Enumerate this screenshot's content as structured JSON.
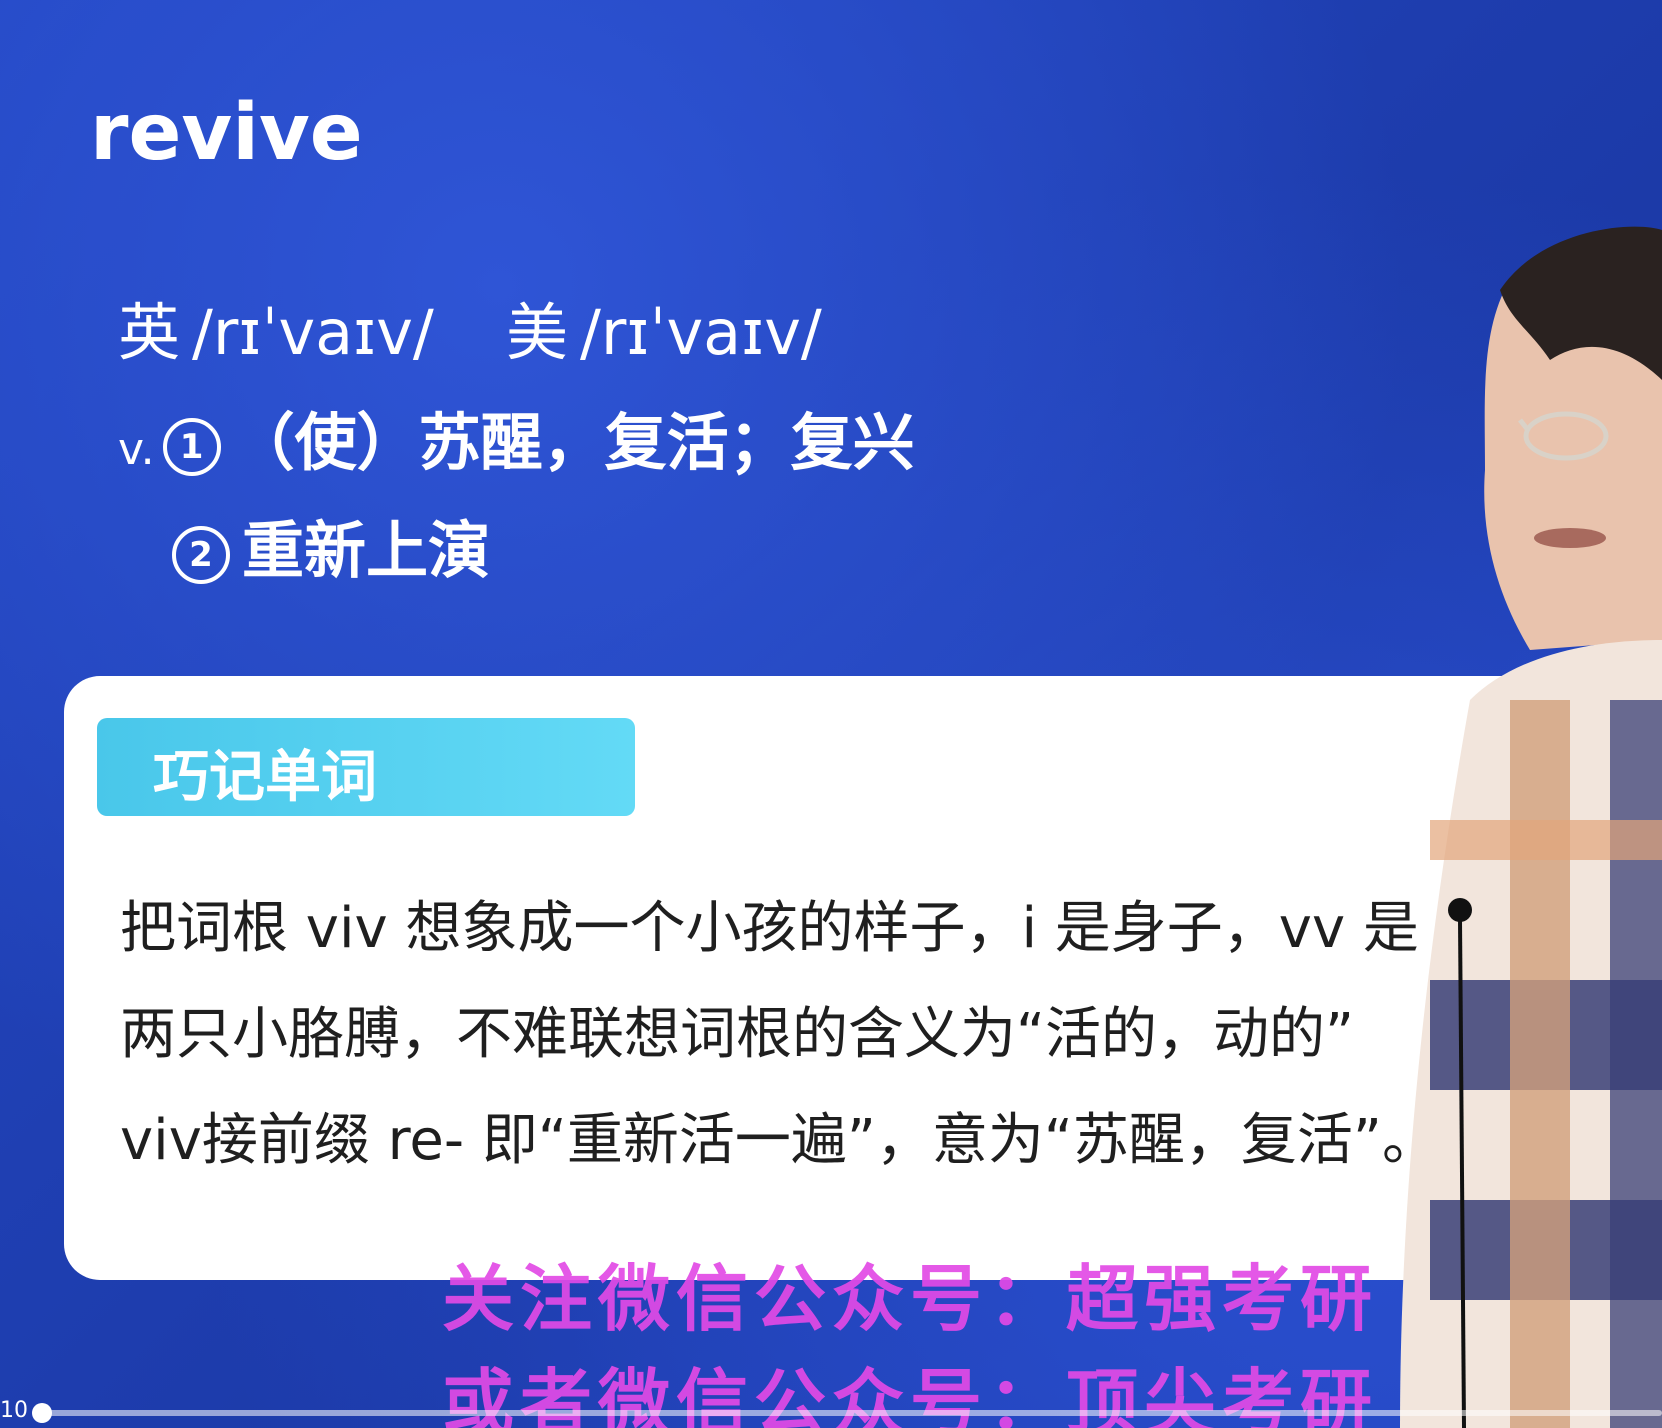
{
  "slide": {
    "word": "revive",
    "phonetic_uk_label": "英",
    "phonetic_uk": "/rɪˈvaɪv/",
    "phonetic_us_label": "美",
    "phonetic_us": "/rɪˈvaɪv/",
    "part_of_speech": "v.",
    "def1_number": "1",
    "def1_text": "（使）苏醒，复活；复兴",
    "def2_number": "2",
    "def2_text": "重新上演"
  },
  "card": {
    "tag": "巧记单词",
    "line1": "把词根 viv 想象成一个小孩的样子，i 是身子，vv 是",
    "line2": "两只小胳膊，不难联想词根的含义为“活的，动的”",
    "line3": "viv接前缀 re- 即“重新活一遍”，意为“苏醒，复活”。"
  },
  "watermark": {
    "line1": "关注微信公众号：超强考研",
    "line2": "或者微信公众号：顶尖考研"
  },
  "player": {
    "time": "10",
    "progress_percent": 1
  },
  "colors": {
    "background": "#1d3fb4",
    "tag": "#55d0f0",
    "watermark": "#e24ae6"
  }
}
